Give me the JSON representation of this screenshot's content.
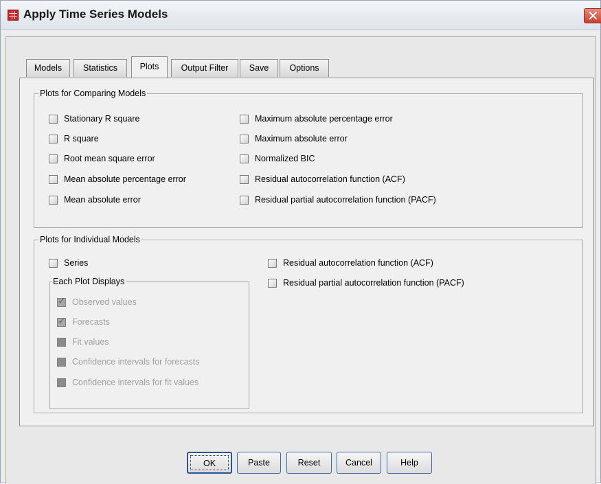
{
  "window": {
    "title": "Apply Time Series Models"
  },
  "tabs": [
    {
      "label": "Models"
    },
    {
      "label": "Statistics"
    },
    {
      "label": "Plots"
    },
    {
      "label": "Output Filter"
    },
    {
      "label": "Save"
    },
    {
      "label": "Options"
    }
  ],
  "active_tab": "Plots",
  "comparing_group": {
    "title": "Plots for Comparing Models",
    "left": [
      {
        "label": "Stationary R square",
        "checked": false
      },
      {
        "label": "R square",
        "checked": false
      },
      {
        "label": "Root mean square error",
        "checked": false
      },
      {
        "label": "Mean absolute percentage error",
        "checked": false
      },
      {
        "label": "Mean absolute error",
        "checked": false
      }
    ],
    "right": [
      {
        "label": "Maximum absolute percentage error",
        "checked": false
      },
      {
        "label": "Maximum absolute error",
        "checked": false
      },
      {
        "label": "Normalized BIC",
        "checked": false
      },
      {
        "label": "Residual autocorrelation function (ACF)",
        "checked": false
      },
      {
        "label": "Residual partial autocorrelation function (PACF)",
        "checked": false
      }
    ]
  },
  "individual_group": {
    "title": "Plots for Individual Models",
    "series": {
      "label": "Series",
      "checked": false
    },
    "display_group": {
      "title": "Each Plot Displays",
      "items": [
        {
          "label": "Observed values",
          "checked": true,
          "enabled": false
        },
        {
          "label": "Forecasts",
          "checked": true,
          "enabled": false
        },
        {
          "label": "Fit values",
          "checked": false,
          "enabled": false
        },
        {
          "label": "Confidence intervals for forecasts",
          "checked": false,
          "enabled": false
        },
        {
          "label": "Confidence intervals for fit values",
          "checked": false,
          "enabled": false
        }
      ]
    },
    "right": [
      {
        "label": "Residual autocorrelation function (ACF)",
        "checked": false
      },
      {
        "label": "Residual partial autocorrelation function (PACF)",
        "checked": false
      }
    ]
  },
  "buttons": {
    "ok": "OK",
    "paste": "Paste",
    "reset": "Reset",
    "cancel": "Cancel",
    "help": "Help"
  },
  "colors": {
    "button_border": "#3c67a8",
    "close_button": "#c9412f",
    "app_icon": "#c82424"
  }
}
